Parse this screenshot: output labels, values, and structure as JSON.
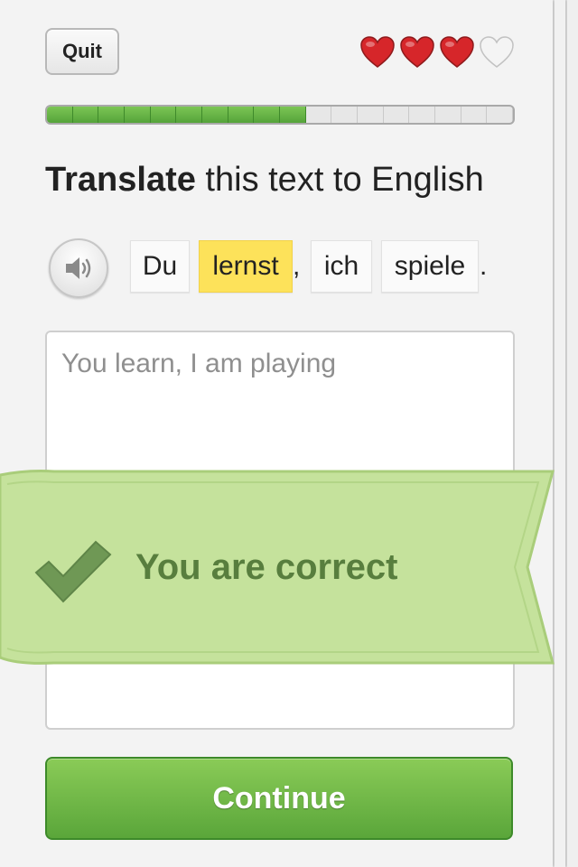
{
  "header": {
    "quit_label": "Quit",
    "hearts": {
      "total": 4,
      "remaining": 3,
      "full_color": "#d6262a",
      "empty_color": "#f4f4f4"
    }
  },
  "progress": {
    "total_segments": 18,
    "completed_segments": 10,
    "fill_color": "#6bb64a"
  },
  "prompt": {
    "bold": "Translate",
    "rest": " this text to English"
  },
  "sentence": {
    "audio_icon": "speaker-icon",
    "tokens": [
      {
        "text": "Du",
        "highlighted": false
      },
      {
        "text": "lernst",
        "highlighted": true
      },
      {
        "text": "ich",
        "highlighted": false
      },
      {
        "text": "spiele",
        "highlighted": false
      }
    ],
    "comma": ",",
    "period": ".",
    "highlight_color": "#fde25a"
  },
  "answer": {
    "text": "You learn, I am playing"
  },
  "feedback": {
    "message": "You are correct",
    "icon": "checkmark-icon",
    "ribbon_color": "#c5e29c"
  },
  "footer": {
    "continue_label": "Continue",
    "button_color": "#6ab549"
  }
}
